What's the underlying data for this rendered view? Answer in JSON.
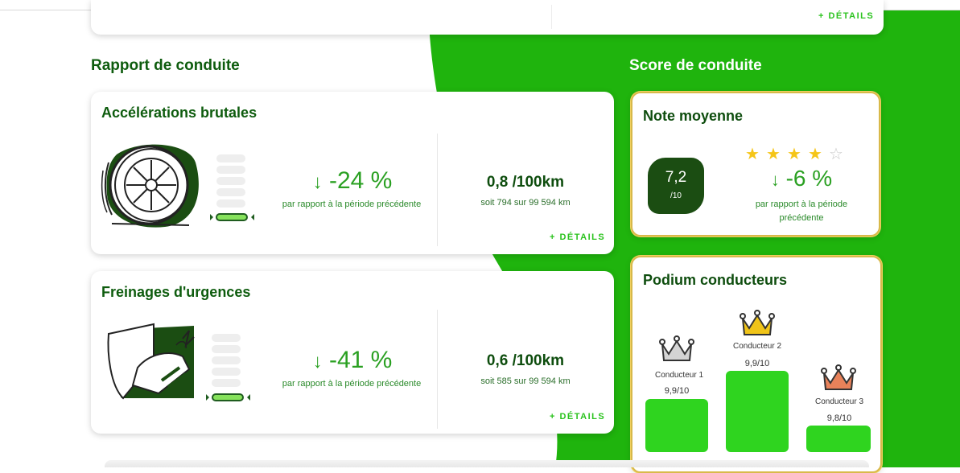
{
  "colors": {
    "brand_green": "#1fb40d",
    "dark_green": "#0e5c0e",
    "accent_green": "#2fd41f",
    "star_yellow": "#f5c518"
  },
  "top_card": {
    "details_link": "+ DÉTAILS"
  },
  "report": {
    "section_title": "Rapport de conduite",
    "cards": [
      {
        "title": "Accélérations brutales",
        "icon": "tire-icon",
        "change": "-24 %",
        "change_caption": "par rapport à la période précédente",
        "value": "0,8 /100km",
        "value_caption": "soit 794 sur 99 594 km",
        "details_link": "+ DÉTAILS",
        "gauge_level_of_6": 1
      },
      {
        "title": "Freinages d'urgences",
        "icon": "brake-pedal-icon",
        "change": "-41 %",
        "change_caption": "par rapport à la période précédente",
        "value": "0,6 /100km",
        "value_caption": "soit 585 sur 99 594 km",
        "details_link": "+ DÉTAILS",
        "gauge_level_of_6": 1
      }
    ]
  },
  "score": {
    "section_title": "Score de conduite",
    "average": {
      "title": "Note moyenne",
      "value": "7,2",
      "max": "/10",
      "stars": 4,
      "stars_total": 5,
      "change": "-6 %",
      "change_caption_line1": "par rapport à la période",
      "change_caption_line2": "précédente"
    },
    "podium": {
      "title": "Podium conducteurs",
      "drivers": [
        {
          "name": "Conducteur 1",
          "score": "9,9/10",
          "crown_color": "#b0b0b0",
          "rank": 2
        },
        {
          "name": "Conducteur 2",
          "score": "9,9/10",
          "crown_color": "#f0c419",
          "rank": 1
        },
        {
          "name": "Conducteur 3",
          "score": "9,8/10",
          "crown_color": "#e8825a",
          "rank": 3
        }
      ]
    }
  }
}
